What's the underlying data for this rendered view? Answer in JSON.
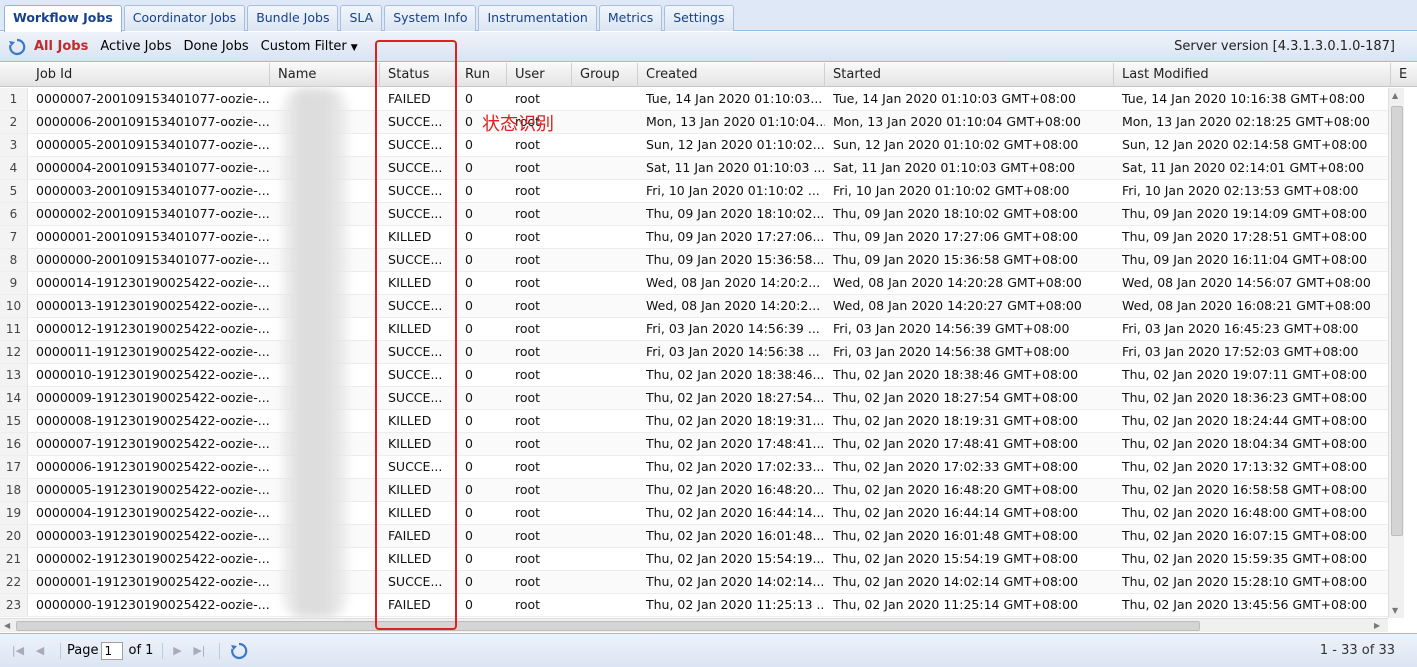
{
  "tabs": [
    "Workflow Jobs",
    "Coordinator Jobs",
    "Bundle Jobs",
    "SLA",
    "System Info",
    "Instrumentation",
    "Metrics",
    "Settings"
  ],
  "toolbar": {
    "filters": [
      "All Jobs",
      "Active Jobs",
      "Done Jobs"
    ],
    "custom_filter": "Custom Filter",
    "server_version": "Server version [4.3.1.3.0.1.0-187]"
  },
  "grid": {
    "columns": [
      "Job Id",
      "Name",
      "Status",
      "Run",
      "User",
      "Group",
      "Created",
      "Started",
      "Last Modified",
      "E"
    ],
    "rows": [
      {
        "n": "1",
        "job_id": "0000007-200109153401077-oozie-...",
        "status": "FAILED",
        "run": "0",
        "user": "root",
        "created": "Tue, 14 Jan 2020 01:10:03...",
        "started": "Tue, 14 Jan 2020 01:10:03 GMT+08:00",
        "modified": "Tue, 14 Jan 2020 10:16:38 GMT+08:00"
      },
      {
        "n": "2",
        "job_id": "0000006-200109153401077-oozie-...",
        "status": "SUCCE...",
        "run": "0",
        "user": "root",
        "created": "Mon, 13 Jan 2020 01:10:04...",
        "started": "Mon, 13 Jan 2020 01:10:04 GMT+08:00",
        "modified": "Mon, 13 Jan 2020 02:18:25 GMT+08:00"
      },
      {
        "n": "3",
        "job_id": "0000005-200109153401077-oozie-...",
        "status": "SUCCE...",
        "run": "0",
        "user": "root",
        "created": "Sun, 12 Jan 2020 01:10:02...",
        "started": "Sun, 12 Jan 2020 01:10:02 GMT+08:00",
        "modified": "Sun, 12 Jan 2020 02:14:58 GMT+08:00"
      },
      {
        "n": "4",
        "job_id": "0000004-200109153401077-oozie-...",
        "status": "SUCCE...",
        "run": "0",
        "user": "root",
        "created": "Sat, 11 Jan 2020 01:10:03 ...",
        "started": "Sat, 11 Jan 2020 01:10:03 GMT+08:00",
        "modified": "Sat, 11 Jan 2020 02:14:01 GMT+08:00"
      },
      {
        "n": "5",
        "job_id": "0000003-200109153401077-oozie-...",
        "status": "SUCCE...",
        "run": "0",
        "user": "root",
        "created": "Fri, 10 Jan 2020 01:10:02 ...",
        "started": "Fri, 10 Jan 2020 01:10:02 GMT+08:00",
        "modified": "Fri, 10 Jan 2020 02:13:53 GMT+08:00"
      },
      {
        "n": "6",
        "job_id": "0000002-200109153401077-oozie-...",
        "status": "SUCCE...",
        "run": "0",
        "user": "root",
        "created": "Thu, 09 Jan 2020 18:10:02...",
        "started": "Thu, 09 Jan 2020 18:10:02 GMT+08:00",
        "modified": "Thu, 09 Jan 2020 19:14:09 GMT+08:00"
      },
      {
        "n": "7",
        "job_id": "0000001-200109153401077-oozie-...",
        "status": "KILLED",
        "run": "0",
        "user": "root",
        "created": "Thu, 09 Jan 2020 17:27:06...",
        "started": "Thu, 09 Jan 2020 17:27:06 GMT+08:00",
        "modified": "Thu, 09 Jan 2020 17:28:51 GMT+08:00"
      },
      {
        "n": "8",
        "job_id": "0000000-200109153401077-oozie-...",
        "status": "SUCCE...",
        "run": "0",
        "user": "root",
        "created": "Thu, 09 Jan 2020 15:36:58...",
        "started": "Thu, 09 Jan 2020 15:36:58 GMT+08:00",
        "modified": "Thu, 09 Jan 2020 16:11:04 GMT+08:00"
      },
      {
        "n": "9",
        "job_id": "0000014-191230190025422-oozie-...",
        "status": "KILLED",
        "run": "0",
        "user": "root",
        "created": "Wed, 08 Jan 2020 14:20:2...",
        "started": "Wed, 08 Jan 2020 14:20:28 GMT+08:00",
        "modified": "Wed, 08 Jan 2020 14:56:07 GMT+08:00"
      },
      {
        "n": "10",
        "job_id": "0000013-191230190025422-oozie-...",
        "status": "SUCCE...",
        "run": "0",
        "user": "root",
        "created": "Wed, 08 Jan 2020 14:20:2...",
        "started": "Wed, 08 Jan 2020 14:20:27 GMT+08:00",
        "modified": "Wed, 08 Jan 2020 16:08:21 GMT+08:00"
      },
      {
        "n": "11",
        "job_id": "0000012-191230190025422-oozie-...",
        "status": "KILLED",
        "run": "0",
        "user": "root",
        "created": "Fri, 03 Jan 2020 14:56:39 ...",
        "started": "Fri, 03 Jan 2020 14:56:39 GMT+08:00",
        "modified": "Fri, 03 Jan 2020 16:45:23 GMT+08:00"
      },
      {
        "n": "12",
        "job_id": "0000011-191230190025422-oozie-...",
        "status": "SUCCE...",
        "run": "0",
        "user": "root",
        "created": "Fri, 03 Jan 2020 14:56:38 ...",
        "started": "Fri, 03 Jan 2020 14:56:38 GMT+08:00",
        "modified": "Fri, 03 Jan 2020 17:52:03 GMT+08:00"
      },
      {
        "n": "13",
        "job_id": "0000010-191230190025422-oozie-...",
        "status": "SUCCE...",
        "run": "0",
        "user": "root",
        "created": "Thu, 02 Jan 2020 18:38:46...",
        "started": "Thu, 02 Jan 2020 18:38:46 GMT+08:00",
        "modified": "Thu, 02 Jan 2020 19:07:11 GMT+08:00"
      },
      {
        "n": "14",
        "job_id": "0000009-191230190025422-oozie-...",
        "status": "SUCCE...",
        "run": "0",
        "user": "root",
        "created": "Thu, 02 Jan 2020 18:27:54...",
        "started": "Thu, 02 Jan 2020 18:27:54 GMT+08:00",
        "modified": "Thu, 02 Jan 2020 18:36:23 GMT+08:00"
      },
      {
        "n": "15",
        "job_id": "0000008-191230190025422-oozie-...",
        "status": "KILLED",
        "run": "0",
        "user": "root",
        "created": "Thu, 02 Jan 2020 18:19:31...",
        "started": "Thu, 02 Jan 2020 18:19:31 GMT+08:00",
        "modified": "Thu, 02 Jan 2020 18:24:44 GMT+08:00"
      },
      {
        "n": "16",
        "job_id": "0000007-191230190025422-oozie-...",
        "status": "KILLED",
        "run": "0",
        "user": "root",
        "created": "Thu, 02 Jan 2020 17:48:41...",
        "started": "Thu, 02 Jan 2020 17:48:41 GMT+08:00",
        "modified": "Thu, 02 Jan 2020 18:04:34 GMT+08:00"
      },
      {
        "n": "17",
        "job_id": "0000006-191230190025422-oozie-...",
        "status": "SUCCE...",
        "run": "0",
        "user": "root",
        "created": "Thu, 02 Jan 2020 17:02:33...",
        "started": "Thu, 02 Jan 2020 17:02:33 GMT+08:00",
        "modified": "Thu, 02 Jan 2020 17:13:32 GMT+08:00"
      },
      {
        "n": "18",
        "job_id": "0000005-191230190025422-oozie-...",
        "status": "KILLED",
        "run": "0",
        "user": "root",
        "created": "Thu, 02 Jan 2020 16:48:20...",
        "started": "Thu, 02 Jan 2020 16:48:20 GMT+08:00",
        "modified": "Thu, 02 Jan 2020 16:58:58 GMT+08:00"
      },
      {
        "n": "19",
        "job_id": "0000004-191230190025422-oozie-...",
        "status": "KILLED",
        "run": "0",
        "user": "root",
        "created": "Thu, 02 Jan 2020 16:44:14...",
        "started": "Thu, 02 Jan 2020 16:44:14 GMT+08:00",
        "modified": "Thu, 02 Jan 2020 16:48:00 GMT+08:00"
      },
      {
        "n": "20",
        "job_id": "0000003-191230190025422-oozie-...",
        "status": "FAILED",
        "run": "0",
        "user": "root",
        "created": "Thu, 02 Jan 2020 16:01:48...",
        "started": "Thu, 02 Jan 2020 16:01:48 GMT+08:00",
        "modified": "Thu, 02 Jan 2020 16:07:15 GMT+08:00"
      },
      {
        "n": "21",
        "job_id": "0000002-191230190025422-oozie-...",
        "status": "KILLED",
        "run": "0",
        "user": "root",
        "created": "Thu, 02 Jan 2020 15:54:19...",
        "started": "Thu, 02 Jan 2020 15:54:19 GMT+08:00",
        "modified": "Thu, 02 Jan 2020 15:59:35 GMT+08:00"
      },
      {
        "n": "22",
        "job_id": "0000001-191230190025422-oozie-...",
        "status": "SUCCE...",
        "run": "0",
        "user": "root",
        "created": "Thu, 02 Jan 2020 14:02:14...",
        "started": "Thu, 02 Jan 2020 14:02:14 GMT+08:00",
        "modified": "Thu, 02 Jan 2020 15:28:10 GMT+08:00"
      },
      {
        "n": "23",
        "job_id": "0000000-191230190025422-oozie-...",
        "status": "FAILED",
        "run": "0",
        "user": "root",
        "created": "Thu, 02 Jan 2020 11:25:13 ...",
        "started": "Thu, 02 Jan 2020 11:25:14 GMT+08:00",
        "modified": "Thu, 02 Jan 2020 13:45:56 GMT+08:00"
      }
    ]
  },
  "annotation": {
    "text": "状态识别",
    "color": "#e02020"
  },
  "pager": {
    "page_label": "Page",
    "page_value": "1",
    "of_label": "of 1",
    "display": "1 - 33 of 33"
  },
  "colors": {
    "accent": "#15428b",
    "selected_filter": "#c12a2a",
    "annotation": "#e02020"
  }
}
